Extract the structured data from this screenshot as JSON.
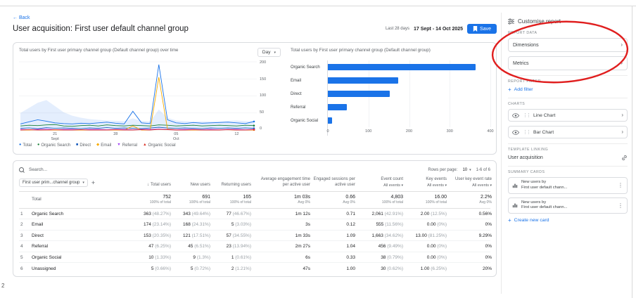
{
  "artifacts": {
    "page_number": "2"
  },
  "header": {
    "back_label": "Back",
    "title": "User acquisition: First user default channel group",
    "date_range_label": "Last 28 days",
    "date_range": "17 Sept - 14 Oct 2025",
    "save_label": "Save"
  },
  "charts": {
    "line": {
      "title": "Total users by First user primary channel group (Default channel group) over time",
      "granularity": "Day",
      "y_max": 200,
      "y_ticks": [
        200,
        150,
        100,
        50,
        0
      ],
      "x_ticks": [
        {
          "label": "21",
          "sub": "Sept",
          "index": 4
        },
        {
          "label": "28",
          "sub": "",
          "index": 11
        },
        {
          "label": "05",
          "sub": "Oct",
          "index": 18
        },
        {
          "label": "12",
          "sub": "",
          "index": 25
        }
      ],
      "band": {
        "upper": [
          50,
          65,
          80,
          88,
          70,
          52,
          42,
          36,
          32,
          30,
          28,
          27,
          26,
          34,
          27,
          25,
          60,
          36,
          28,
          26,
          25,
          25,
          25,
          26,
          27,
          28,
          26,
          25
        ],
        "lower": [
          4,
          5,
          7,
          8,
          6,
          5,
          4,
          4,
          4,
          4,
          4,
          4,
          4,
          5,
          4,
          4,
          8,
          5,
          4,
          4,
          4,
          4,
          4,
          4,
          4,
          4,
          4,
          4
        ]
      },
      "series": [
        {
          "name": "Total",
          "color": "#1a73e8",
          "marker": "●",
          "values": [
            18,
            24,
            30,
            26,
            21,
            19,
            18,
            20,
            19,
            21,
            23,
            20,
            18,
            55,
            21,
            19,
            192,
            30,
            21,
            19,
            22,
            20,
            21,
            22,
            23,
            21,
            19,
            25
          ]
        },
        {
          "name": "Organic Search",
          "color": "#188038",
          "marker": "●",
          "values": [
            12,
            14,
            13,
            15,
            16,
            12,
            11,
            13,
            14,
            12,
            15,
            13,
            12,
            14,
            13,
            12,
            15,
            14,
            12,
            13,
            14,
            12,
            13,
            14,
            13,
            12,
            14,
            13
          ]
        },
        {
          "name": "Direct",
          "color": "#185abc",
          "marker": "■",
          "values": [
            5,
            6,
            4,
            7,
            5,
            6,
            5,
            4,
            6,
            5,
            7,
            5,
            6,
            5,
            4,
            6,
            8,
            6,
            5,
            6,
            5,
            4,
            6,
            5,
            6,
            5,
            6,
            5
          ]
        },
        {
          "name": "Email",
          "color": "#f9ab00",
          "marker": "◆",
          "values": [
            0,
            0,
            1,
            0,
            0,
            0,
            0,
            0,
            0,
            0,
            0,
            0,
            0,
            12,
            0,
            0,
            155,
            3,
            1,
            0,
            0,
            0,
            0,
            1,
            1,
            0,
            0,
            0
          ]
        },
        {
          "name": "Referral",
          "color": "#a142f4",
          "marker": "▼",
          "values": [
            2,
            1,
            2,
            3,
            1,
            2,
            2,
            1,
            2,
            2,
            1,
            2,
            2,
            1,
            2,
            2,
            3,
            2,
            1,
            2,
            2,
            1,
            2,
            1,
            2,
            2,
            1,
            2
          ]
        },
        {
          "name": "Organic Social",
          "color": "#d93025",
          "marker": "▲",
          "values": [
            0,
            1,
            0,
            0,
            1,
            0,
            0,
            1,
            0,
            0,
            0,
            1,
            0,
            0,
            1,
            0,
            2,
            1,
            0,
            0,
            1,
            0,
            0,
            0,
            1,
            0,
            0,
            1
          ]
        }
      ]
    },
    "bar": {
      "title": "Total users by First user primary channel group (Default channel group)",
      "categories": [
        "Organic Search",
        "Email",
        "Direct",
        "Referral",
        "Organic Social"
      ],
      "values": [
        363,
        174,
        153,
        47,
        10
      ],
      "x_max": 400,
      "x_ticks": [
        0,
        100,
        200,
        300,
        400
      ],
      "bar_color": "#1a73e8"
    }
  },
  "table": {
    "search_placeholder": "Search...",
    "rows_per_page_label": "Rows per page:",
    "rows_per_page": "10",
    "pagination": "1-6 of 6",
    "dimension_selector": "First user prim...channel group",
    "columns": [
      {
        "label": "Total users",
        "sub": ""
      },
      {
        "label": "New users",
        "sub": ""
      },
      {
        "label": "Returning users",
        "sub": ""
      },
      {
        "label": "Average engagement time per active user",
        "sub": ""
      },
      {
        "label": "Engaged sessions per active user",
        "sub": ""
      },
      {
        "label": "Event count",
        "sub": "All events"
      },
      {
        "label": "Key events",
        "sub": "All events"
      },
      {
        "label": "User key event rate",
        "sub": "All events"
      }
    ],
    "totals": {
      "label": "Total",
      "cells": [
        {
          "value": "752",
          "sub": "100% of total"
        },
        {
          "value": "691",
          "sub": "100% of total"
        },
        {
          "value": "165",
          "sub": "100% of total"
        },
        {
          "value": "1m 03s",
          "sub": "Avg 0%"
        },
        {
          "value": "0.66",
          "sub": "Avg 0%"
        },
        {
          "value": "4,803",
          "sub": "100% of total"
        },
        {
          "value": "16.00",
          "sub": "100% of total"
        },
        {
          "value": "2.2%",
          "sub": "Avg 0%"
        }
      ]
    },
    "rows": [
      {
        "num": "1",
        "channel": "Organic Search",
        "cells": [
          [
            "363",
            "(48.27%)"
          ],
          [
            "343",
            "(49.64%)"
          ],
          [
            "77",
            "(46.67%)"
          ],
          [
            "1m 12s",
            ""
          ],
          [
            "0.71",
            ""
          ],
          [
            "2,061",
            "(42.91%)"
          ],
          [
            "2.00",
            "(12.5%)"
          ],
          [
            "0.56%",
            ""
          ]
        ]
      },
      {
        "num": "2",
        "channel": "Email",
        "cells": [
          [
            "174",
            "(23.14%)"
          ],
          [
            "168",
            "(24.31%)"
          ],
          [
            "5",
            "(3.03%)"
          ],
          [
            "3s",
            ""
          ],
          [
            "0.12",
            ""
          ],
          [
            "555",
            "(11.56%)"
          ],
          [
            "0.00",
            "(0%)"
          ],
          [
            "0%",
            ""
          ]
        ]
      },
      {
        "num": "3",
        "channel": "Direct",
        "cells": [
          [
            "153",
            "(20.35%)"
          ],
          [
            "121",
            "(17.51%)"
          ],
          [
            "57",
            "(34.55%)"
          ],
          [
            "1m 33s",
            ""
          ],
          [
            "1.09",
            ""
          ],
          [
            "1,663",
            "(34.62%)"
          ],
          [
            "13.00",
            "(81.25%)"
          ],
          [
            "9.29%",
            ""
          ]
        ]
      },
      {
        "num": "4",
        "channel": "Referral",
        "cells": [
          [
            "47",
            "(6.25%)"
          ],
          [
            "45",
            "(6.51%)"
          ],
          [
            "23",
            "(13.94%)"
          ],
          [
            "2m 27s",
            ""
          ],
          [
            "1.04",
            ""
          ],
          [
            "456",
            "(9.49%)"
          ],
          [
            "0.00",
            "(0%)"
          ],
          [
            "0%",
            ""
          ]
        ]
      },
      {
        "num": "5",
        "channel": "Organic Social",
        "cells": [
          [
            "10",
            "(1.33%)"
          ],
          [
            "9",
            "(1.3%)"
          ],
          [
            "1",
            "(0.61%)"
          ],
          [
            "6s",
            ""
          ],
          [
            "0.33",
            ""
          ],
          [
            "38",
            "(0.79%)"
          ],
          [
            "0.00",
            "(0%)"
          ],
          [
            "0%",
            ""
          ]
        ]
      },
      {
        "num": "6",
        "channel": "Unassigned",
        "cells": [
          [
            "5",
            "(0.66%)"
          ],
          [
            "5",
            "(0.72%)"
          ],
          [
            "2",
            "(1.21%)"
          ],
          [
            "47s",
            ""
          ],
          [
            "1.00",
            ""
          ],
          [
            "30",
            "(0.62%)"
          ],
          [
            "1.00",
            "(6.25%)"
          ],
          [
            "20%",
            ""
          ]
        ]
      }
    ]
  },
  "panel": {
    "title": "Customise report",
    "report_data": {
      "label": "REPORT DATA",
      "items": [
        "Dimensions",
        "Metrics"
      ]
    },
    "report_filter": {
      "label": "REPORT FILTER",
      "add_label": "Add filter"
    },
    "charts_section": {
      "label": "CHARTS",
      "items": [
        "Line Chart",
        "Bar Chart"
      ]
    },
    "template_linking": {
      "label": "TEMPLATE LINKING",
      "value": "User acquisition"
    },
    "summary_cards": {
      "label": "SUMMARY CARDS",
      "cards": [
        {
          "line1": "New users by",
          "line2": "First user default chann..."
        },
        {
          "line1": "New users by",
          "line2": "First user default chann..."
        }
      ],
      "create_label": "Create new card"
    }
  }
}
